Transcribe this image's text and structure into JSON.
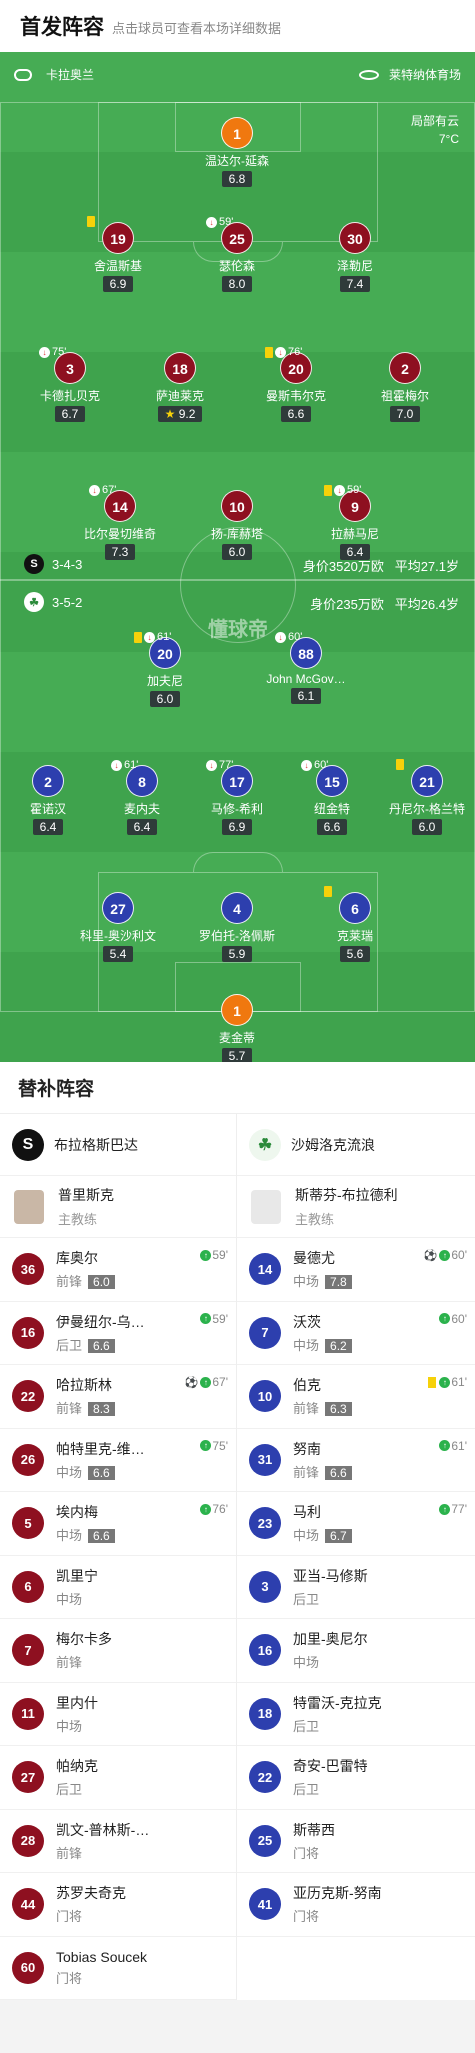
{
  "header": {
    "title": "首发阵容",
    "subtitle": "点击球员可查看本场详细数据"
  },
  "match": {
    "coach_label": "卡拉奥兰",
    "stadium": "莱特纳体育场",
    "weather": "局部有云",
    "temp": "7°C"
  },
  "home": {
    "name": "布拉格斯巴达",
    "formation": "3-4-3",
    "value": "身价3520万欧",
    "age": "平均27.1岁",
    "color": "#8e1020",
    "players": [
      {
        "num": "1",
        "name": "温达尔-延森",
        "rating": "6.8",
        "gk": true
      },
      {
        "num": "19",
        "name": "舍温斯基",
        "rating": "6.9",
        "yellow": true
      },
      {
        "num": "25",
        "name": "瑟伦森",
        "rating": "8.0",
        "sub": "59'",
        "captain": true,
        "goal": true
      },
      {
        "num": "30",
        "name": "泽勒尼",
        "rating": "7.4"
      },
      {
        "num": "3",
        "name": "卡德扎贝克",
        "rating": "6.7",
        "sub": "75'"
      },
      {
        "num": "18",
        "name": "萨迪莱克",
        "rating": "9.2",
        "best": true,
        "goal": true
      },
      {
        "num": "20",
        "name": "曼斯韦尔克",
        "rating": "6.6",
        "sub": "76'",
        "yellow": true
      },
      {
        "num": "2",
        "name": "祖霍梅尔",
        "rating": "7.0",
        "goal": true
      },
      {
        "num": "14",
        "name": "比尔曼切维奇",
        "rating": "7.3",
        "sub": "67'"
      },
      {
        "num": "10",
        "name": "扬-库赫塔",
        "rating": "6.0"
      },
      {
        "num": "9",
        "name": "拉赫马尼",
        "rating": "6.4",
        "sub": "59'",
        "yellow": true
      }
    ]
  },
  "away": {
    "name": "沙姆洛克流浪",
    "formation": "3-5-2",
    "value": "身价235万欧",
    "age": "平均26.4岁",
    "color": "#2d3fae",
    "players": [
      {
        "num": "20",
        "name": "加夫尼",
        "rating": "6.0",
        "sub": "61'",
        "yellow": true
      },
      {
        "num": "88",
        "name": "John McGov…",
        "rating": "6.1",
        "sub": "60'"
      },
      {
        "num": "2",
        "name": "霍诺汉",
        "rating": "6.4"
      },
      {
        "num": "8",
        "name": "麦内夫",
        "rating": "6.4",
        "sub": "61'"
      },
      {
        "num": "17",
        "name": "马修-希利",
        "rating": "6.9",
        "sub": "77'"
      },
      {
        "num": "15",
        "name": "纽金特",
        "rating": "6.6",
        "sub": "60'"
      },
      {
        "num": "21",
        "name": "丹尼尔-格兰特",
        "rating": "6.0",
        "yellow": true
      },
      {
        "num": "27",
        "name": "科里-奥沙利文",
        "rating": "5.4"
      },
      {
        "num": "4",
        "name": "罗伯托-洛佩斯",
        "rating": "5.9",
        "captain": true
      },
      {
        "num": "6",
        "name": "克莱瑞",
        "rating": "5.6",
        "yellow": true
      },
      {
        "num": "1",
        "name": "麦金蒂",
        "rating": "5.7",
        "gk": true
      }
    ]
  },
  "subs": {
    "title": "替补阵容",
    "role_coach": "主教练",
    "home_coach": "普里斯克",
    "away_coach": "斯蒂芬-布拉德利",
    "home": [
      {
        "num": "36",
        "name": "库奥尔",
        "pos": "前锋",
        "rating": "6.0",
        "in": "59'"
      },
      {
        "num": "16",
        "name": "伊曼纽尔-乌…",
        "pos": "后卫",
        "rating": "6.6",
        "in": "59'"
      },
      {
        "num": "22",
        "name": "哈拉斯林",
        "pos": "前锋",
        "rating": "8.3",
        "in": "67'",
        "goal": true
      },
      {
        "num": "26",
        "name": "帕特里克-维…",
        "pos": "中场",
        "rating": "6.6",
        "in": "75'"
      },
      {
        "num": "5",
        "name": "埃内梅",
        "pos": "中场",
        "rating": "6.6",
        "in": "76'"
      },
      {
        "num": "6",
        "name": "凯里宁",
        "pos": "中场"
      },
      {
        "num": "7",
        "name": "梅尔卡多",
        "pos": "前锋"
      },
      {
        "num": "11",
        "name": "里内什",
        "pos": "中场"
      },
      {
        "num": "27",
        "name": "帕纳克",
        "pos": "后卫"
      },
      {
        "num": "28",
        "name": "凯文-普林斯-…",
        "pos": "前锋"
      },
      {
        "num": "44",
        "name": "苏罗夫奇克",
        "pos": "门将"
      },
      {
        "num": "60",
        "name": "Tobias Soucek",
        "pos": "门将"
      }
    ],
    "away": [
      {
        "num": "14",
        "name": "曼德尤",
        "pos": "中场",
        "rating": "7.8",
        "in": "60'",
        "goal": true
      },
      {
        "num": "7",
        "name": "沃茨",
        "pos": "中场",
        "rating": "6.2",
        "in": "60'"
      },
      {
        "num": "10",
        "name": "伯克",
        "pos": "前锋",
        "rating": "6.3",
        "in": "61'",
        "yellow": true
      },
      {
        "num": "31",
        "name": "努南",
        "pos": "前锋",
        "rating": "6.6",
        "in": "61'"
      },
      {
        "num": "23",
        "name": "马利",
        "pos": "中场",
        "rating": "6.7",
        "in": "77'"
      },
      {
        "num": "3",
        "name": "亚当-马修斯",
        "pos": "后卫"
      },
      {
        "num": "16",
        "name": "加里-奥尼尔",
        "pos": "中场"
      },
      {
        "num": "18",
        "name": "特雷沃-克拉克",
        "pos": "后卫"
      },
      {
        "num": "22",
        "name": "奇安-巴雷特",
        "pos": "后卫"
      },
      {
        "num": "25",
        "name": "斯蒂西",
        "pos": "门将"
      },
      {
        "num": "41",
        "name": "亚历克斯-努南",
        "pos": "门将"
      }
    ]
  },
  "watermark": "懂球帝"
}
